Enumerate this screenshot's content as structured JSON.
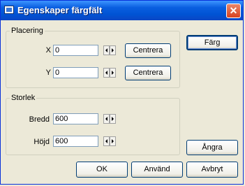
{
  "window": {
    "title": "Egenskaper färgfält"
  },
  "placering": {
    "legend": "Placering",
    "x_label": "X",
    "x_value": "0",
    "y_label": "Y",
    "y_value": "0",
    "centrera_label": "Centrera"
  },
  "storlek": {
    "legend": "Storlek",
    "bredd_label": "Bredd",
    "bredd_value": "600",
    "hojd_label": "Höjd",
    "hojd_value": "600"
  },
  "buttons": {
    "farg": "Färg",
    "angra": "Ångra",
    "ok": "OK",
    "anvand": "Använd",
    "avbryt": "Avbryt"
  }
}
